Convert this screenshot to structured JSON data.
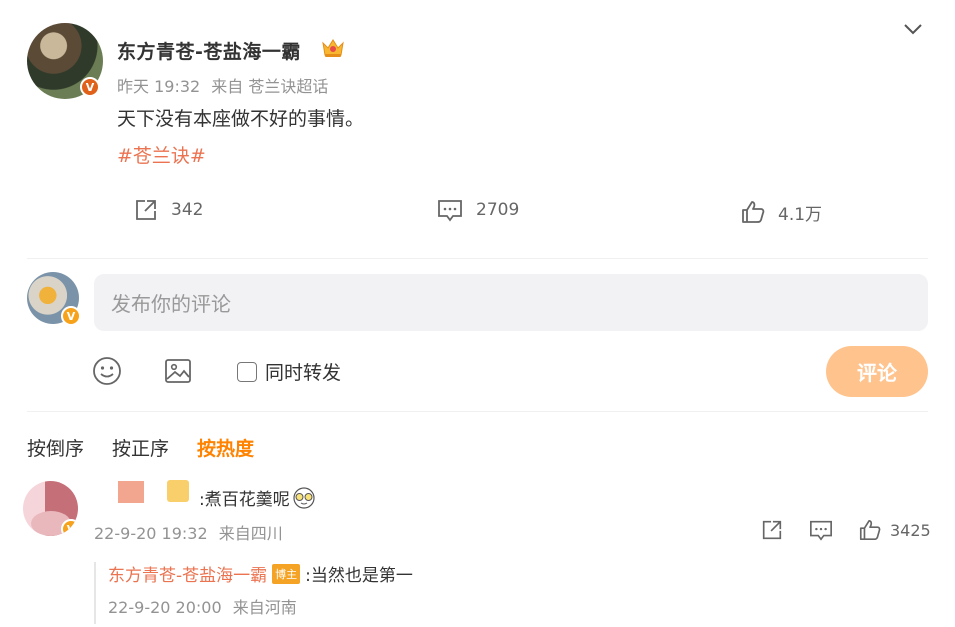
{
  "post": {
    "author": "东方青苍-苍盐海一霸",
    "time": "昨天 19:32",
    "source_prefix": "来自",
    "source": "苍兰诀超话",
    "text": "天下没有本座做不好的事情。",
    "topic": "#苍兰诀#",
    "reposts": "342",
    "comments": "2709",
    "likes": "4.1万"
  },
  "compose": {
    "placeholder": "发布你的评论",
    "repost_label": "同时转发",
    "submit_label": "评论"
  },
  "sort": {
    "tabs": [
      "按倒序",
      "按正序",
      "按热度"
    ],
    "active": "按热度"
  },
  "comments": [
    {
      "text": ":煮百花羹呢",
      "time": "22-9-20 19:32",
      "location": "来自四川",
      "likes": "3425",
      "replies": [
        {
          "author": "东方青苍-苍盐海一霸",
          "badge": "博主",
          "text": ":当然也是第一",
          "time": "22-9-20 20:00",
          "location": "来自河南"
        }
      ]
    }
  ],
  "colors": {
    "accent": "#ff8200",
    "link": "#eb7350",
    "submit_bg": "#ffc38e",
    "muted": "#939393"
  },
  "icons": [
    "chevron-down-icon",
    "verified-badge-icon",
    "crown-icon",
    "repost-icon",
    "comment-icon",
    "like-icon",
    "emoji-icon",
    "image-icon",
    "sunglasses-emoji-icon"
  ]
}
